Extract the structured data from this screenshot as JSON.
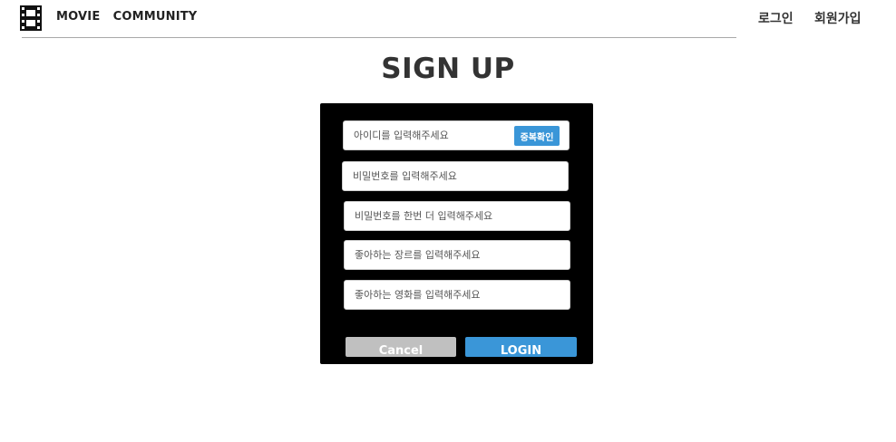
{
  "header": {
    "logo_icon": "film-strip-icon",
    "brand": "MOVIE   COMMUNITY",
    "nav": {
      "login": "로그인",
      "signup": "회원가입"
    }
  },
  "page": {
    "title": "SIGN UP"
  },
  "form": {
    "id_placeholder": "아이디를 입력해주세요",
    "check_duplicate_label": "중복확인",
    "password_placeholder": "비밀번호를 입력해주세요",
    "password_confirm_placeholder": "비밀번호를 한번 더 입력해주세요",
    "genre_placeholder": "좋아하는 장르를 입력해주세요",
    "movie_placeholder": "좋아하는 영화를 입력해주세요",
    "cancel_label": "Cancel",
    "login_label": "LOGIN"
  },
  "colors": {
    "accent": "#3a96d8",
    "panel": "#000000",
    "cancel": "#c0c0c0"
  }
}
